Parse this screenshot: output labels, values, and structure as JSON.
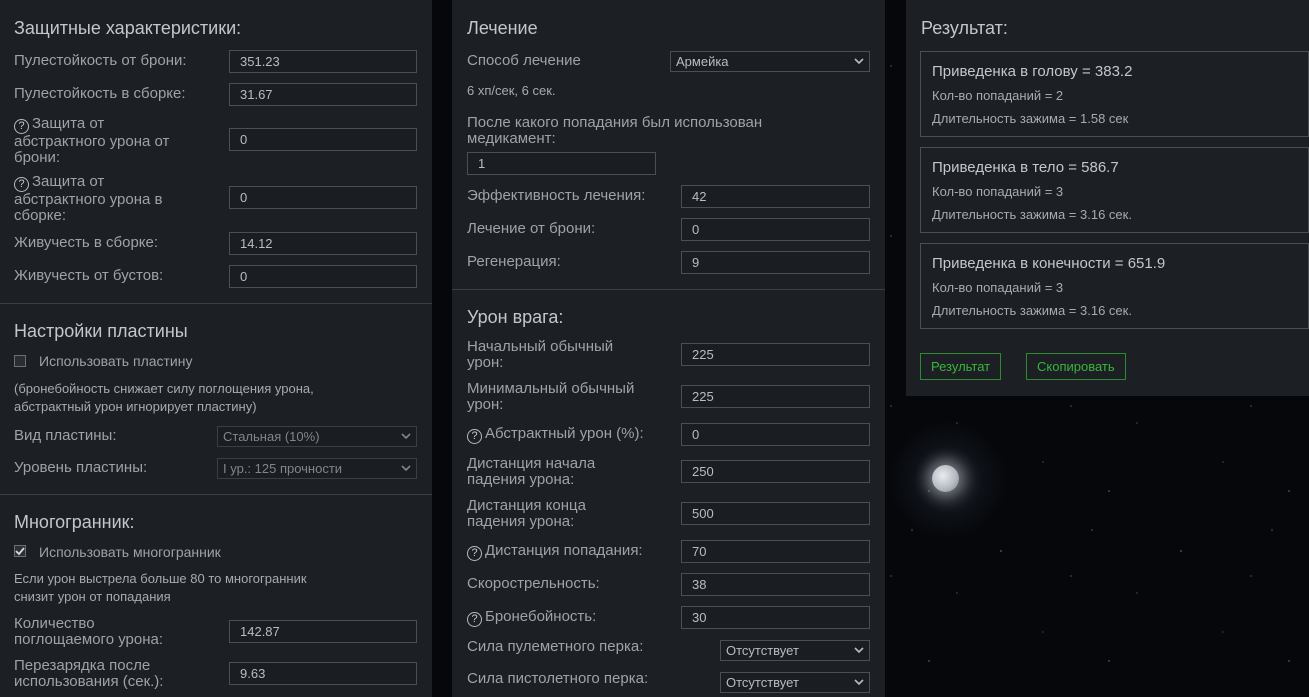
{
  "protection": {
    "title": "Защитные характеристики:",
    "armor_bullet_res_label": "Пулестойкость от брони:",
    "armor_bullet_res_value": "351.23",
    "build_bullet_res_label": "Пулестойкость в сборке:",
    "build_bullet_res_value": "31.67",
    "abstract_armor_label_1": "Защита от",
    "abstract_armor_label_2": "абстрактного урона от",
    "abstract_armor_label_3": "брони:",
    "abstract_armor_value": "0",
    "abstract_build_label_1": "Защита от",
    "abstract_build_label_2": "абстрактного урона в",
    "abstract_build_label_3": "сборке:",
    "abstract_build_value": "0",
    "vitality_build_label": "Живучесть в сборке:",
    "vitality_build_value": "14.12",
    "vitality_boost_label": "Живучесть от бустов:",
    "vitality_boost_value": "0",
    "help_glyph": "?"
  },
  "plate": {
    "title": "Настройки пластины",
    "use_label": "Использовать пластину",
    "use_checked": false,
    "note_1": "(бронебойность снижает силу поглощения урона,",
    "note_2": "абстрактный урон игнорирует пластину)",
    "type_label": "Вид пластины:",
    "type_value": "Стальная (10%)",
    "level_label": "Уровень пластины:",
    "level_value": "I ур.: 125 прочности"
  },
  "poly": {
    "title": "Многогранник:",
    "use_label": "Использовать многогранник",
    "use_checked": true,
    "note_1": "Если урон выстрела больше 80 то многогранник",
    "note_2": "снизит урон от попадания",
    "absorb_label_1": "Количество",
    "absorb_label_2": "поглощаемого урона:",
    "absorb_value": "142.87",
    "reload_label_1": "Перезарядка после",
    "reload_label_2": "использования (сек.):",
    "reload_value": "9.63"
  },
  "heal": {
    "title": "Лечение",
    "method_label": "Способ лечение",
    "method_value": "Армейка",
    "method_info": "6 хп/сек, 6 сек.",
    "after_hit_label_1": "После какого попадания был использован",
    "after_hit_label_2": "медикамент:",
    "after_hit_value": "1",
    "efficiency_label": "Эффективность лечения:",
    "efficiency_value": "42",
    "armor_heal_label": "Лечение от брони:",
    "armor_heal_value": "0",
    "regen_label": "Регенерация:",
    "regen_value": "9"
  },
  "enemy": {
    "title": "Урон врага:",
    "base_dmg_label_1": "Начальный обычный",
    "base_dmg_label_2": "урон:",
    "base_dmg_value": "225",
    "min_dmg_label_1": "Минимальный обычный",
    "min_dmg_label_2": "урон:",
    "min_dmg_value": "225",
    "abstract_label": "Абстрактный урон (%):",
    "abstract_value": "0",
    "falloff_start_label_1": "Дистанция начала",
    "falloff_start_label_2": "падения урона:",
    "falloff_start_value": "250",
    "falloff_end_label_1": "Дистанция конца",
    "falloff_end_label_2": "падения урона:",
    "falloff_end_value": "500",
    "hit_dist_label": "Дистанция попадания:",
    "hit_dist_value": "70",
    "rof_label": "Скорострельность:",
    "rof_value": "38",
    "pen_label": "Бронебойность:",
    "pen_value": "30",
    "mg_perk_label": "Сила пулеметного перка:",
    "mg_perk_value": "Отсутствует",
    "pistol_perk_label": "Сила пистолетного перка:",
    "pistol_perk_value": "Отсутствует"
  },
  "result": {
    "title": "Результат:",
    "cards": [
      {
        "title": "Приведенка в голову = 383.2",
        "hits": "Кол-во попаданий = 2",
        "duration": "Длительность зажима = 1.58 сек"
      },
      {
        "title": "Приведенка в тело = 586.7",
        "hits": "Кол-во попаданий = 3",
        "duration": "Длительность зажима = 3.16 сек."
      },
      {
        "title": "Приведенка в конечности = 651.9",
        "hits": "Кол-во попаданий = 3",
        "duration": "Длительность зажима = 3.16 сек."
      }
    ],
    "result_button": "Результат",
    "copy_button": "Скопировать"
  },
  "colors": {
    "panel": "#1c1f24",
    "accent_green": "#3ab53a",
    "border": "#4a4f56"
  }
}
